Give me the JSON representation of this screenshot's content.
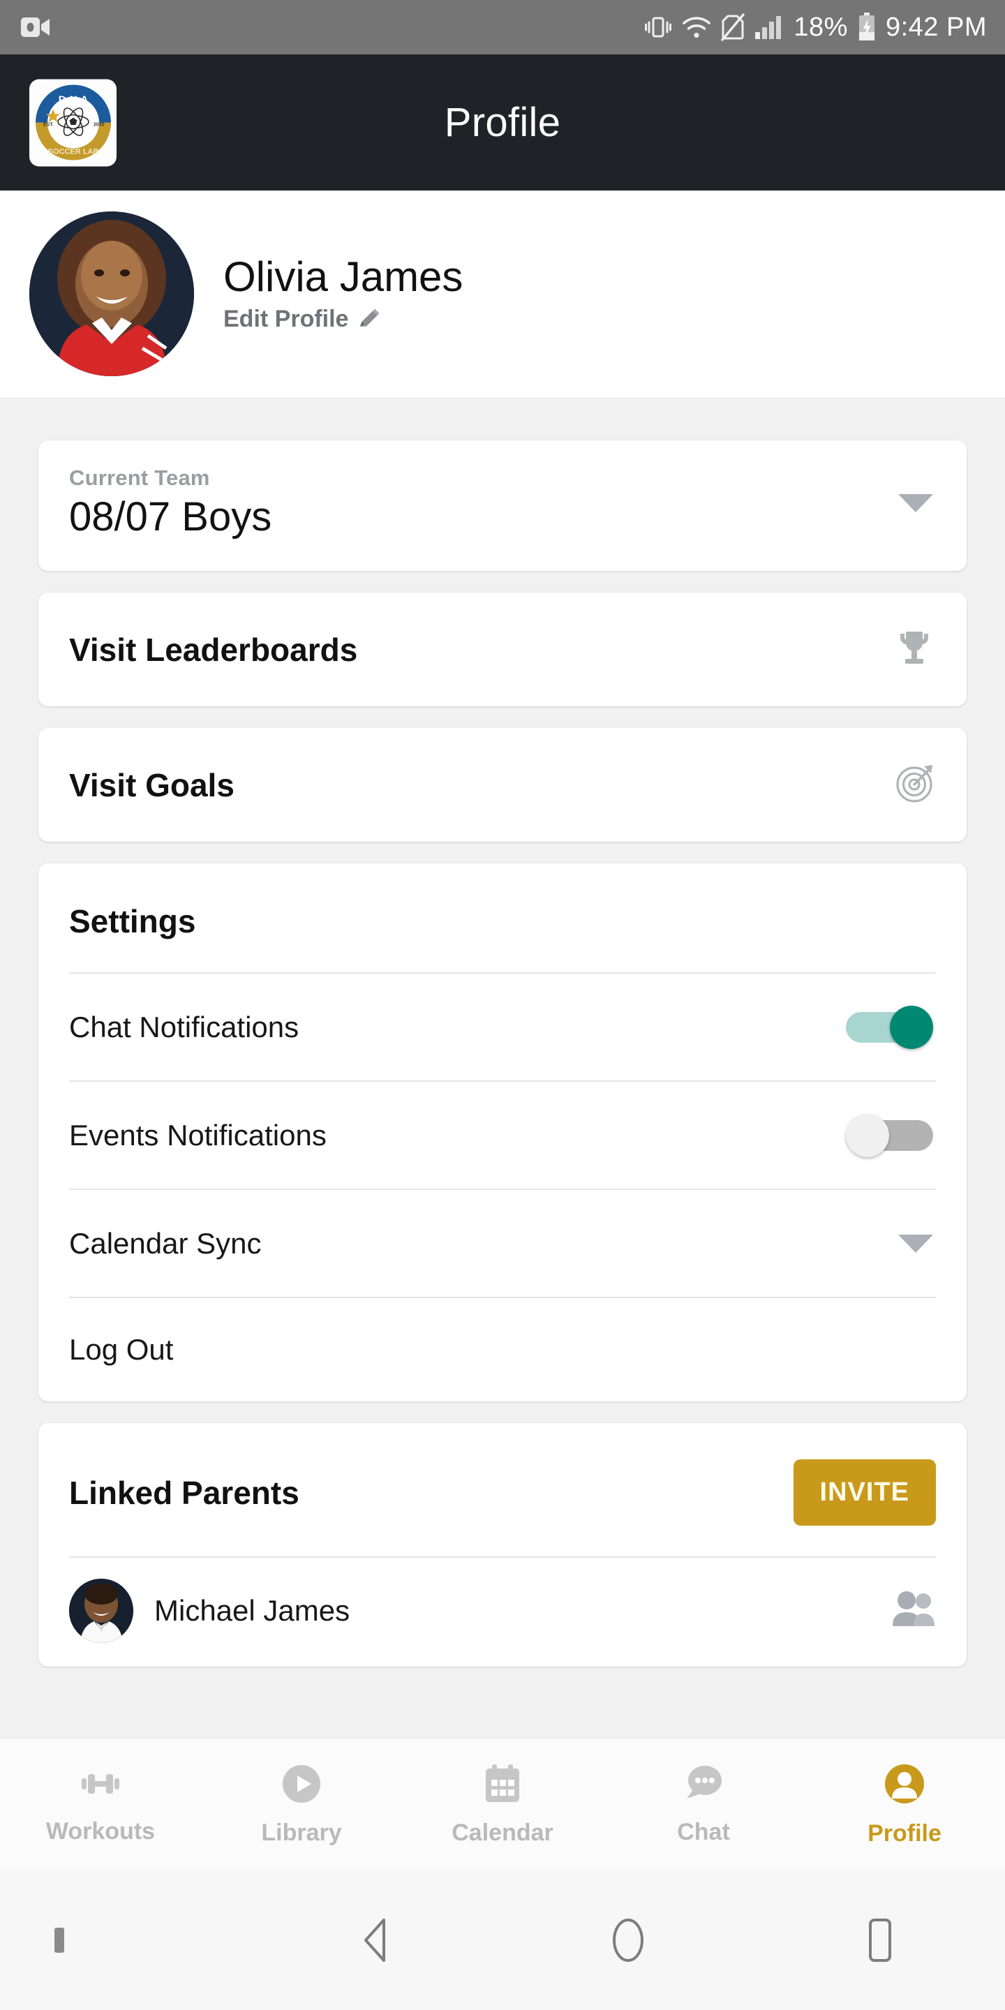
{
  "statusbar": {
    "recording_icon": "video-camera-icon",
    "vibrate_icon": "vibrate-icon",
    "wifi_icon": "wifi-icon",
    "nosim_icon": "no-sim-icon",
    "signal_icon": "cellular-signal-icon",
    "battery_percent": "18%",
    "battery_icon": "battery-charging-icon",
    "time": "9:42 PM"
  },
  "appbar": {
    "title": "Profile",
    "logo": {
      "name": "dna-soccer-lab-logo",
      "top_text": "D·N·A",
      "bottom_text": "SOCCER LAB",
      "est_left": "EST.",
      "est_right": "2020",
      "blue": "#1c5b9c",
      "gold": "#c49a2b"
    },
    "background": "#212227"
  },
  "profile": {
    "name": "Olivia James",
    "edit_label": "Edit Profile",
    "edit_icon": "pencil-icon",
    "avatar_name": "profile-avatar"
  },
  "team": {
    "label": "Current Team",
    "value": "08/07 Boys",
    "dropdown_icon": "chevron-down-icon"
  },
  "links": [
    {
      "label": "Visit Leaderboards",
      "icon": "trophy-icon",
      "name": "visit-leaderboards-card"
    },
    {
      "label": "Visit Goals",
      "icon": "target-icon",
      "name": "visit-goals-card"
    }
  ],
  "settings": {
    "title": "Settings",
    "rows": [
      {
        "label": "Chat Notifications",
        "control": "toggle",
        "state": "on"
      },
      {
        "label": "Events Notifications",
        "control": "toggle",
        "state": "off"
      },
      {
        "label": "Calendar Sync",
        "control": "dropdown"
      },
      {
        "label": "Log Out",
        "control": "none"
      }
    ]
  },
  "linked_parents": {
    "title": "Linked Parents",
    "invite_label": "INVITE",
    "invite_color": "#c9991b",
    "parents": [
      {
        "name": "Michael James",
        "trailing_icon": "people-group-icon"
      }
    ]
  },
  "bottomnav": {
    "active": "Profile",
    "active_color": "#c9991b",
    "inactive_color": "#b9b9b9",
    "items": [
      {
        "label": "Workouts",
        "icon": "dumbbell-icon"
      },
      {
        "label": "Library",
        "icon": "play-circle-icon"
      },
      {
        "label": "Calendar",
        "icon": "calendar-icon"
      },
      {
        "label": "Chat",
        "icon": "chat-bubble-icon"
      },
      {
        "label": "Profile",
        "icon": "person-circle-icon"
      }
    ]
  },
  "sysnav": {
    "back_icon": "back-triangle-icon",
    "home_icon": "home-circle-icon",
    "recents_icon": "recents-square-icon"
  }
}
